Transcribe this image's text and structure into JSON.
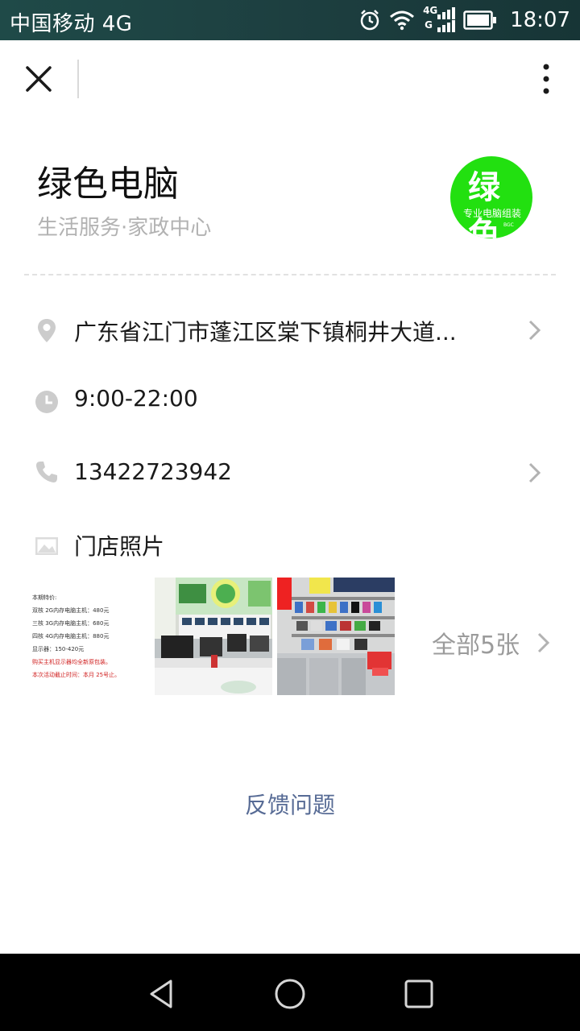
{
  "status_bar": {
    "carrier": "中国移动 4G",
    "network_badge_top": "4G",
    "network_badge_bottom": "G",
    "time": "18:07",
    "icons": [
      "alarm-icon",
      "wifi-icon",
      "signal-icon",
      "battery-icon"
    ]
  },
  "topbar": {
    "icons": [
      "close-icon",
      "more-vertical-icon"
    ]
  },
  "shop": {
    "name": "绿色电脑",
    "category": "生活服务·家政中心",
    "logo": {
      "main_text": "绿色",
      "sub_text": "专业电脑组装",
      "tiny_text": "BGC",
      "color": "#22e010"
    }
  },
  "info": {
    "address": "广东省江门市蓬江区棠下镇桐井大道...",
    "hours": "9:00-22:00",
    "phone": "13422723942",
    "photos_label": "门店照片",
    "icons": [
      "location-icon",
      "clock-icon",
      "phone-icon",
      "image-icon",
      "chevron-right-icon"
    ]
  },
  "photos": {
    "more_label": "全部5张",
    "thumb1": {
      "lines": [
        "本期特价:",
        "双核 2G内存电脑主机：480元",
        "三核 3G内存电脑主机：680元",
        "四核 4G内存电脑主机：880元",
        "显示器：150-420元",
        "购买主机显示器均全新原包装。",
        "本次活动截止时间：本月 25号止。"
      ]
    }
  },
  "footer": {
    "feedback_label": "反馈问题"
  },
  "colors": {
    "status_bar": "#1d4342",
    "link": "#576b95",
    "secondary_text": "#b2b2b2"
  }
}
